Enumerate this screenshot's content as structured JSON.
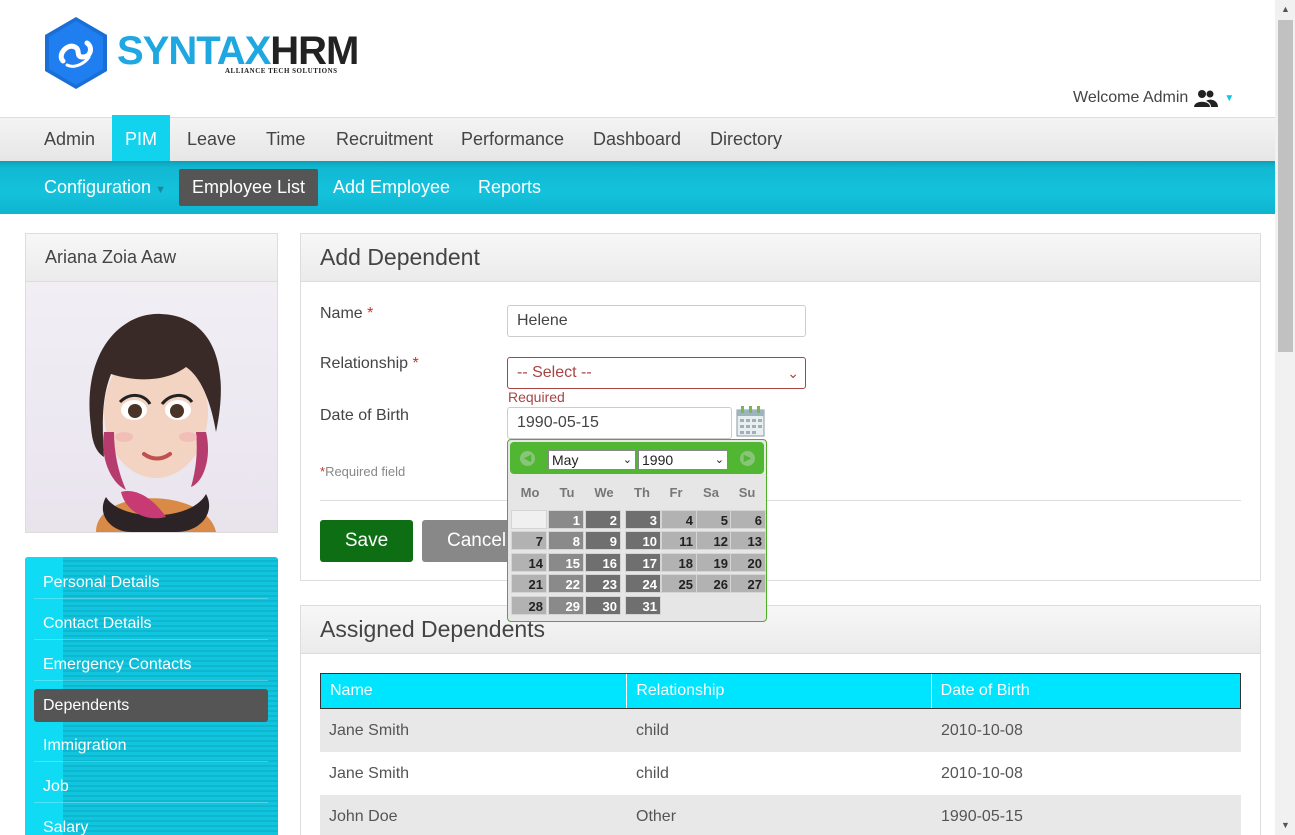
{
  "brand": {
    "name_part1": "SYNTAX",
    "name_part2": "HRM",
    "tagline": "ALLIANCE TECH SOLUTIONS"
  },
  "header": {
    "welcome_text": "Welcome Admin",
    "user_icon": "users-icon"
  },
  "top_nav": [
    "Admin",
    "PIM",
    "Leave",
    "Time",
    "Recruitment",
    "Performance",
    "Dashboard",
    "Directory"
  ],
  "top_nav_active": "PIM",
  "sub_nav": {
    "configuration": "Configuration",
    "employee_list": "Employee List",
    "add_employee": "Add Employee",
    "reports": "Reports"
  },
  "profile": {
    "employee_name": "Ariana Zoia Aaw"
  },
  "side_menu": [
    "Personal Details",
    "Contact Details",
    "Emergency Contacts",
    "Dependents",
    "Immigration",
    "Job",
    "Salary"
  ],
  "side_menu_active": "Dependents",
  "add_dependent": {
    "title": "Add Dependent",
    "name_label": "Name",
    "name_value": "Helene",
    "relationship_label": "Relationship",
    "relationship_value": "-- Select --",
    "relationship_error": "Required",
    "dob_label": "Date of Birth",
    "dob_value": "1990-05-15",
    "required_star": "*",
    "required_note": "Required field",
    "save_label": "Save",
    "cancel_label": "Cancel"
  },
  "datepicker": {
    "month": "May",
    "year": "1990",
    "weekdays": [
      "Mo",
      "Tu",
      "We",
      "Th",
      "Fr",
      "Sa",
      "Su"
    ],
    "days": [
      "1",
      "2",
      "3",
      "4",
      "5",
      "6",
      "7",
      "8",
      "9",
      "10",
      "11",
      "12",
      "13",
      "14",
      "15",
      "16",
      "17",
      "18",
      "19",
      "20",
      "21",
      "22",
      "23",
      "24",
      "25",
      "26",
      "27",
      "28",
      "29",
      "30",
      "31"
    ]
  },
  "assigned": {
    "title": "Assigned Dependents",
    "columns": [
      "Name",
      "Relationship",
      "Date of Birth"
    ],
    "rows": [
      [
        "Jane Smith",
        "child",
        "2010-10-08"
      ],
      [
        "Jane Smith",
        "child",
        "2010-10-08"
      ],
      [
        "John Doe",
        "Other",
        "1990-05-15"
      ]
    ]
  },
  "colors": {
    "accent": "#12d3ee",
    "save_button": "#0e6e13",
    "datepicker_header": "#51b733",
    "error": "#a94442"
  }
}
